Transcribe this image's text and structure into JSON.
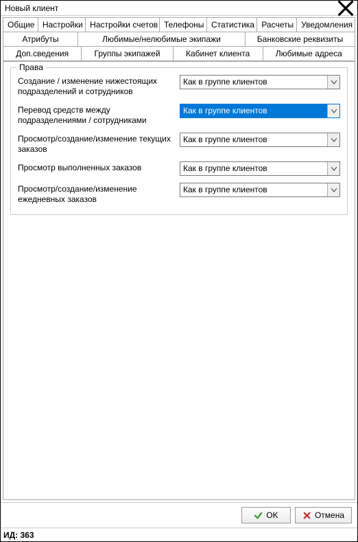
{
  "window": {
    "title": "Новый клиент"
  },
  "tabs": {
    "row1": [
      "Общие",
      "Настройки",
      "Настройки счетов",
      "Телефоны",
      "Статистика",
      "Расчеты",
      "Уведомления"
    ],
    "row2": [
      "Атрибуты",
      "Любимые/нелюбимые экипажи",
      "Банковские реквизиты"
    ],
    "row3": [
      "Доп.сведения",
      "Группы экипажей",
      "Кабинет клиента",
      "Любимые адреса"
    ],
    "active": "Кабинет клиента"
  },
  "fieldset": {
    "legend": "Права",
    "rows": [
      {
        "label": "Создание / изменение нижестоящих подразделений и сотрудников",
        "value": "Как в группе клиентов",
        "focused": false
      },
      {
        "label": "Перевод средств между подразделениями / сотрудниками",
        "value": "Как в группе клиентов",
        "focused": true
      },
      {
        "label": "Просмотр/создание/изменение текущих заказов",
        "value": "Как в группе клиентов",
        "focused": false
      },
      {
        "label": "Просмотр выполненных заказов",
        "value": "Как в группе клиентов",
        "focused": false
      },
      {
        "label": "Просмотр/создание/изменение ежедневных заказов",
        "value": "Как в группе клиентов",
        "focused": false
      }
    ]
  },
  "buttons": {
    "ok": "OK",
    "cancel": "Отмена"
  },
  "status": {
    "text": "ИД: 363"
  }
}
